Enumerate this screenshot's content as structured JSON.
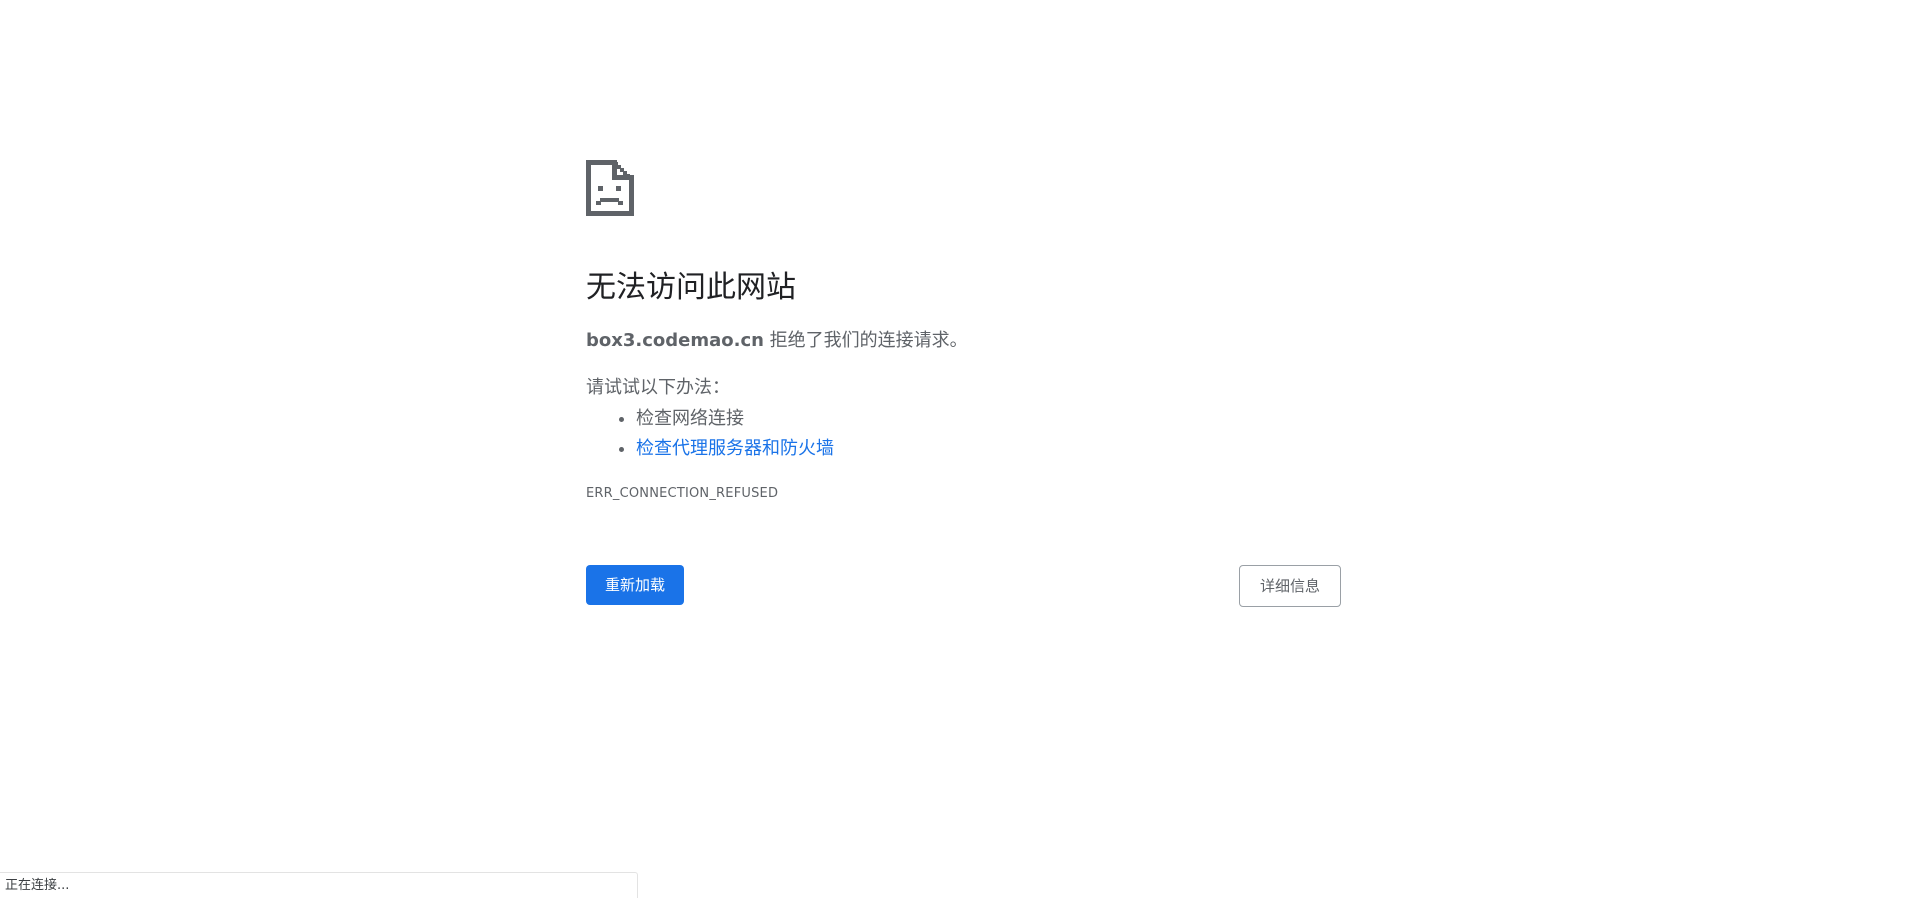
{
  "error_page": {
    "title": "无法访问此网站",
    "summary_host": "box3.codemao.cn",
    "summary_text": " 拒绝了我们的连接请求。",
    "suggestions_heading": "请试试以下办法：",
    "suggestions": [
      {
        "label": "检查网络连接"
      },
      {
        "label": "检查代理服务器和防火墙"
      }
    ],
    "error_code": "ERR_CONNECTION_REFUSED",
    "reload_button": "重新加载",
    "details_button": "详细信息"
  },
  "status_bar": {
    "text": "正在连接..."
  },
  "colors": {
    "accent": "#1a73e8",
    "text_secondary": "#5f6368",
    "icon": "#5f6368"
  },
  "icons": {
    "error": "sad-page-icon"
  }
}
